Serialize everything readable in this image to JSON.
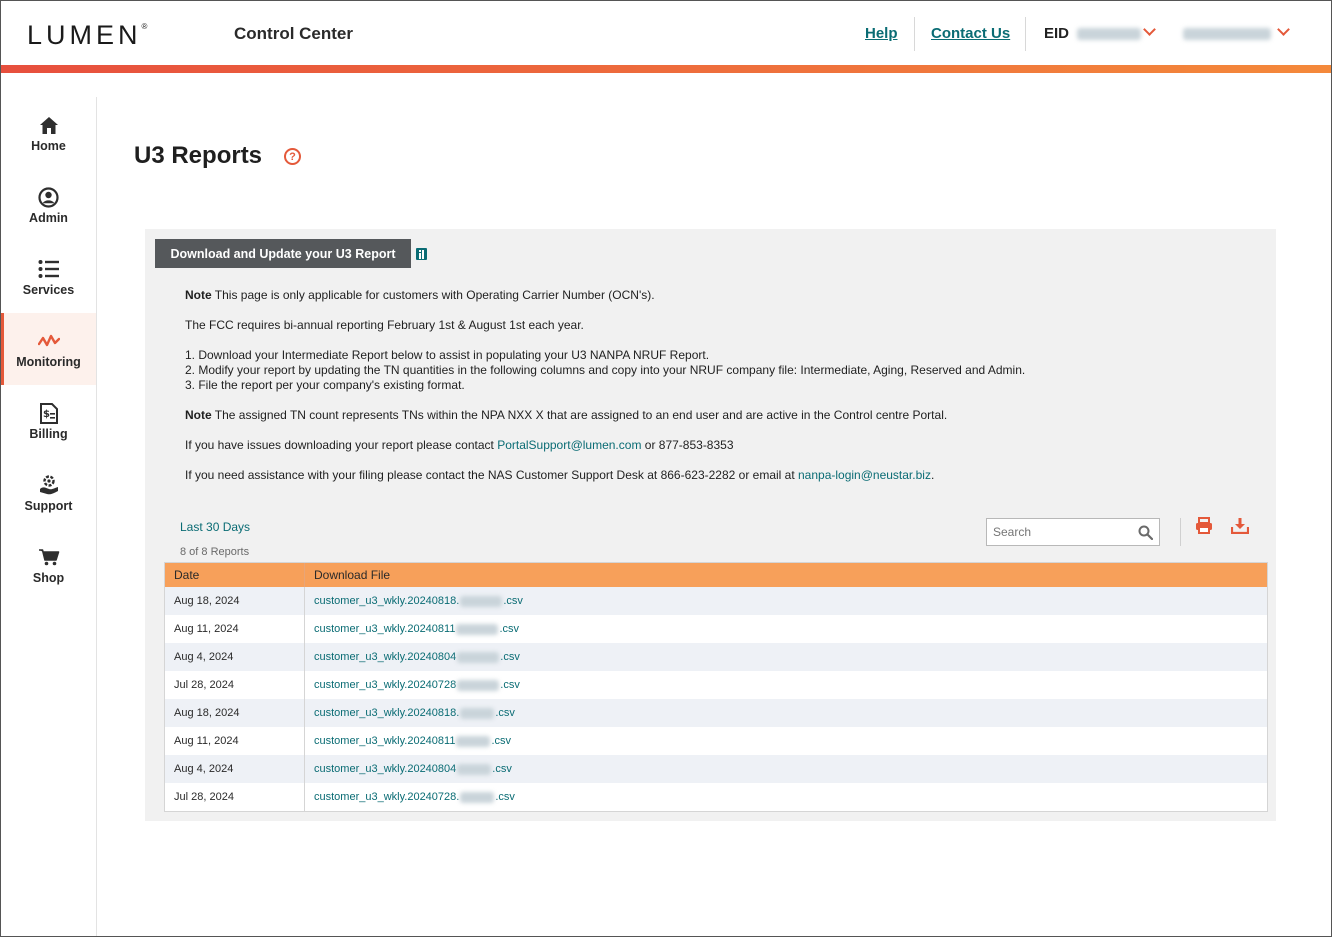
{
  "header": {
    "logo": "LUMEN",
    "app_title": "Control Center",
    "links": {
      "help": "Help",
      "contact": "Contact Us"
    },
    "eid_label": "EID"
  },
  "sidebar": {
    "items": [
      {
        "label": "Home",
        "icon": "home-icon"
      },
      {
        "label": "Admin",
        "icon": "user-icon"
      },
      {
        "label": "Services",
        "icon": "list-icon"
      },
      {
        "label": "Monitoring",
        "icon": "pulse-icon",
        "active": true
      },
      {
        "label": "Billing",
        "icon": "bill-icon"
      },
      {
        "label": "Support",
        "icon": "support-icon"
      },
      {
        "label": "Shop",
        "icon": "cart-icon"
      }
    ]
  },
  "page": {
    "title": "U3 Reports",
    "help_glyph": "?"
  },
  "panel": {
    "tab_label": "Download and Update your U3 Report",
    "notes": {
      "p1_bold": "Note",
      "p1": " This page is only applicable for customers with Operating Carrier Number (OCN's).",
      "p2": "The FCC requires bi-annual reporting February 1st & August 1st each year.",
      "step1": "1. Download your Intermediate Report below to assist in populating your U3 NANPA NRUF Report.",
      "step2": "2. Modify your report by updating the TN quantities in the following columns and copy into your NRUF company file: Intermediate, Aging, Reserved and Admin.",
      "step3": "3. File the report per your company's existing format.",
      "p4_bold": "Note",
      "p4": " The assigned TN count represents TNs within the NPA NXX X that are assigned to an end user and are active in the Control centre Portal.",
      "p5_pre": "If you have issues downloading your report please contact ",
      "p5_link": "PortalSupport@lumen.com",
      "p5_post": " or 877-853-8353",
      "p6_pre": "If you need assistance with your filing please contact the NAS Customer Support Desk at 866-623-2282 or email at ",
      "p6_link": "nanpa-login@neustar.biz",
      "p6_post": "."
    },
    "filter_label": "Last 30 Days",
    "count_label": "8 of 8 Reports",
    "search_placeholder": "Search"
  },
  "table": {
    "columns": [
      "Date",
      "Download File"
    ],
    "rows": [
      {
        "date": "Aug 18, 2024",
        "file_prefix": "customer_u3_wkly.20240818.",
        "file_suffix": ".csv"
      },
      {
        "date": "Aug 11, 2024",
        "file_prefix": "customer_u3_wkly.20240811",
        "file_suffix": ".csv"
      },
      {
        "date": "Aug 4, 2024",
        "file_prefix": "customer_u3_wkly.20240804",
        "file_suffix": ".csv"
      },
      {
        "date": "Jul 28, 2024",
        "file_prefix": "customer_u3_wkly.20240728",
        "file_suffix": ".csv"
      },
      {
        "date": "Aug 18, 2024",
        "file_prefix": "customer_u3_wkly.20240818.",
        "file_suffix": ".csv"
      },
      {
        "date": "Aug 11, 2024",
        "file_prefix": "customer_u3_wkly.20240811",
        "file_suffix": ".csv"
      },
      {
        "date": "Aug 4, 2024",
        "file_prefix": "customer_u3_wkly.20240804",
        "file_suffix": ".csv"
      },
      {
        "date": "Jul 28, 2024",
        "file_prefix": "customer_u3_wkly.20240728.",
        "file_suffix": ".csv"
      }
    ]
  },
  "colors": {
    "accent": "#e4593a",
    "link": "#0a6c74",
    "table_header": "#f7a05a",
    "tab_bg": "#55585b"
  }
}
